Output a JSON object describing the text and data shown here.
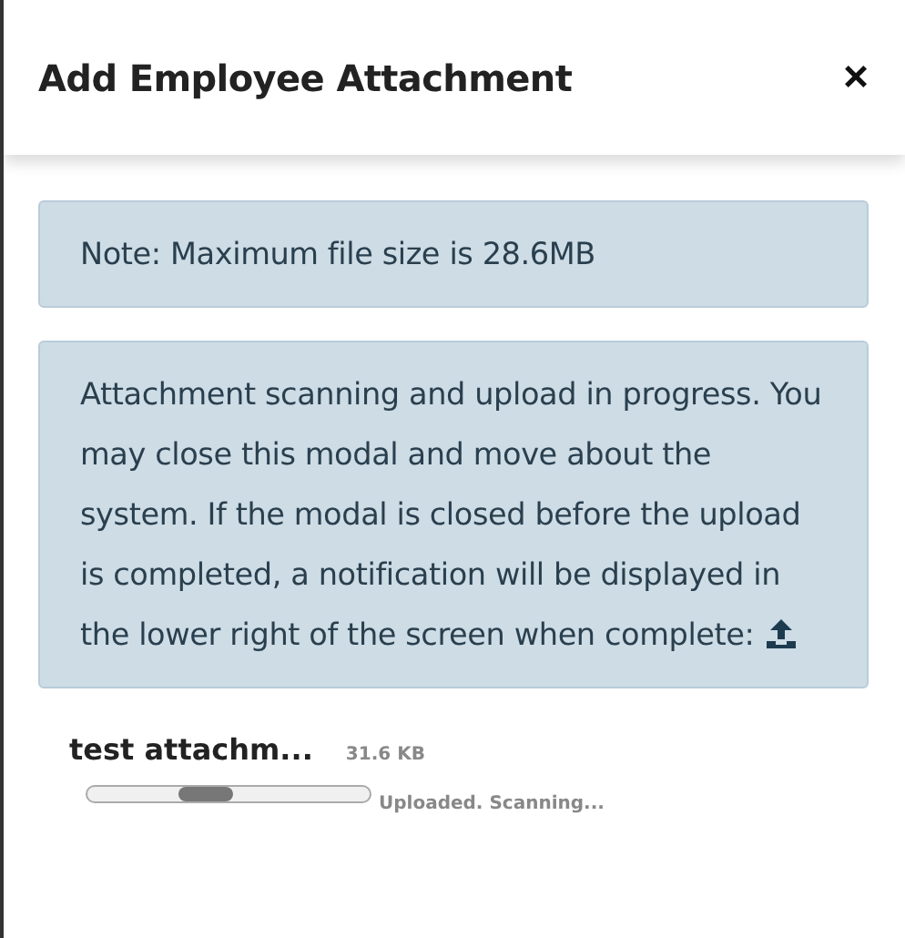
{
  "modal": {
    "title": "Add Employee Attachment",
    "close": "×"
  },
  "notes": [
    {
      "kind": "plain",
      "text": "Note: Maximum file size is 28.6MB"
    },
    {
      "kind": "upload",
      "text": "Attachment scanning and upload in progress. You may close this modal and move about the system. If the modal is closed before the upload is completed, a notification will be displayed in the lower right of the screen when complete:"
    }
  ],
  "file": {
    "name": "test attachm...",
    "size": "31.6 KB",
    "status": "Uploaded. Scanning..."
  }
}
